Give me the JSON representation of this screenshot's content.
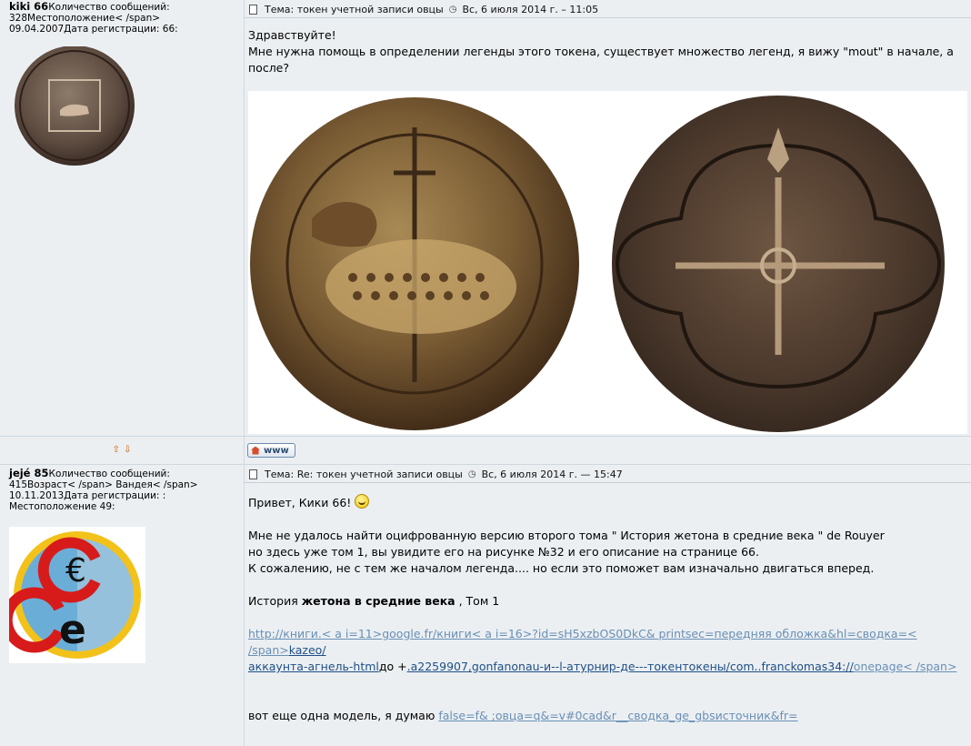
{
  "post1": {
    "author": "kiki 66",
    "meta": "Количество сообщений: 328Местоположение< /span> 09.04.2007Дата регистрации: 66:",
    "header_title": "Тема: токен учетной записи овцы",
    "header_date": "Вс, 6 июля 2014 г. – 11:05",
    "body_line1": "Здравствуйте!",
    "body_line2": "Мне нужна помощь в определении легенды этого токена, существует множество легенд, я вижу \"mout\" в начале, а после?",
    "www_label": "www"
  },
  "post2": {
    "author": "jejé 85",
    "meta": "Количество сообщений: 415Возраст< /span> Вандея< /span> 10.11.2013Дата регистрации: : Местоположение 49:",
    "header_title": "Тема: Re: токен учетной записи овцы",
    "header_date": "Вс, 6 июля 2014 г. — 15:47",
    "greeting": "Привет, Кики 66!",
    "para1_line1": "Мне не удалось найти оцифрованную версию второго тома \" История жетона в средние века \" de Rouyer",
    "para1_line2": "но здесь уже том 1, вы увидите его на рисунке №32 и его описание на странице 66.",
    "para1_line3": "К сожалению, не с тем же началом легенда.... но если это поможет вам изначально двигаться вперед.",
    "history_prefix": "История ",
    "history_bold": "жетона в средние века",
    "history_suffix": " , Том 1",
    "link1_part1": "http://книги.< a i=11>google.fr/книги< a i=16>?id=sH5xzbOS0DkC& printsec=передняя обложка&hl=сводка=< /span>",
    "link1_part2": "kazeo/",
    "link2_part1": "аккаунта-агнель-html",
    "link2_mid": "до +",
    "link2_part2": ".a2259907,gonfanonau-и--l-атурнир-де---токентокены/com..franckomas34://",
    "link2_part3": "onepage< /span>",
    "model_text": "вот еще одна модель, я думаю ",
    "model_link": "false=f& ;овца=q&=v#0cad&r__сводка_ge_gbsисточник&fr="
  },
  "colors": {
    "background": "#ebeff2",
    "link": "#3a6fa6",
    "arrow": "#c85d00"
  }
}
